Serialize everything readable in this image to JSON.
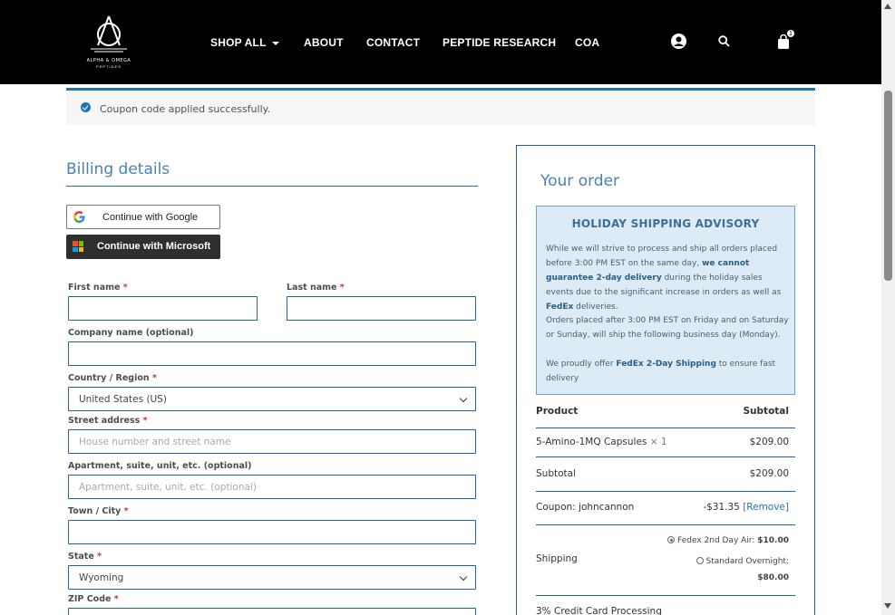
{
  "header": {
    "logo_text": "ALPHA & OMEGA",
    "logo_sub": "PEPTIDES",
    "nav": [
      {
        "label": "SHOP ALL"
      },
      {
        "label": "ABOUT"
      },
      {
        "label": "CONTACT"
      },
      {
        "label": "PEPTIDE RESEARCH"
      },
      {
        "label": "COA"
      }
    ],
    "cart_count": "1",
    "icons": [
      "account-icon",
      "search-icon",
      "cart-icon"
    ]
  },
  "notice": {
    "text": "Coupon code applied successfully.",
    "icon": "check-circle-icon"
  },
  "billing": {
    "title": "Billing details",
    "google_label": "Continue with Google",
    "microsoft_label": "Continue with Microsoft",
    "first_name_label": "First name",
    "last_name_label": "Last name",
    "company_label": "Company name (optional)",
    "country_label": "Country / Region",
    "country_value": "United States (US)",
    "street_label": "Street address",
    "street_placeholder": "House number and street name",
    "apt_label": "Apartment, suite, unit, etc. (optional)",
    "apt_placeholder": "Apartment, suite, unit, etc. (optional)",
    "city_label": "Town / City",
    "state_label": "State",
    "state_value": "Wyoming",
    "zip_label": "ZIP Code",
    "required_mark": "*"
  },
  "order": {
    "title": "Your order",
    "advisory": {
      "title": "HOLIDAY SHIPPING ADVISORY",
      "p1_a": "While we will strive to process and ship all orders placed before 3:00 PM EST on the same day, ",
      "p1_b": "we cannot guarantee 2-day delivery",
      "p1_c": " during the holiday sales events due to the significant increase in orders as well as ",
      "p1_d": "FedEx",
      "p1_e": " deliveries.",
      "p2": "Orders placed after 3:00 PM EST on Friday and on Saturday or Sunday, will ship the following business day (Monday).",
      "p3_a": "We proudly offer ",
      "p3_b": "FedEx 2-Day Shipping",
      "p3_c": " to ensure fast delivery"
    },
    "col_product": "Product",
    "col_subtotal": "Subtotal",
    "item_name": "5-Amino-1MQ Capsules",
    "item_qty": "× 1",
    "item_price": "$209.00",
    "subtotal_label": "Subtotal",
    "subtotal_value": "$209.00",
    "coupon_label": "Coupon: johncannon",
    "coupon_value": "-$31.35",
    "coupon_remove": "[Remove]",
    "shipping_label": "Shipping",
    "ship_opt1_label": "Fedex 2nd Day Air:",
    "ship_opt1_price": "$10.00",
    "ship_opt2_label": "Standard Overnight:",
    "ship_opt2_price": "$80.00",
    "fee_label": "3% Credit Card Processing"
  },
  "colors": {
    "accent": "#1e73be",
    "heading": "#4a81b8",
    "header_bg": "#000000",
    "advisory_bg": "#dcebf6"
  }
}
